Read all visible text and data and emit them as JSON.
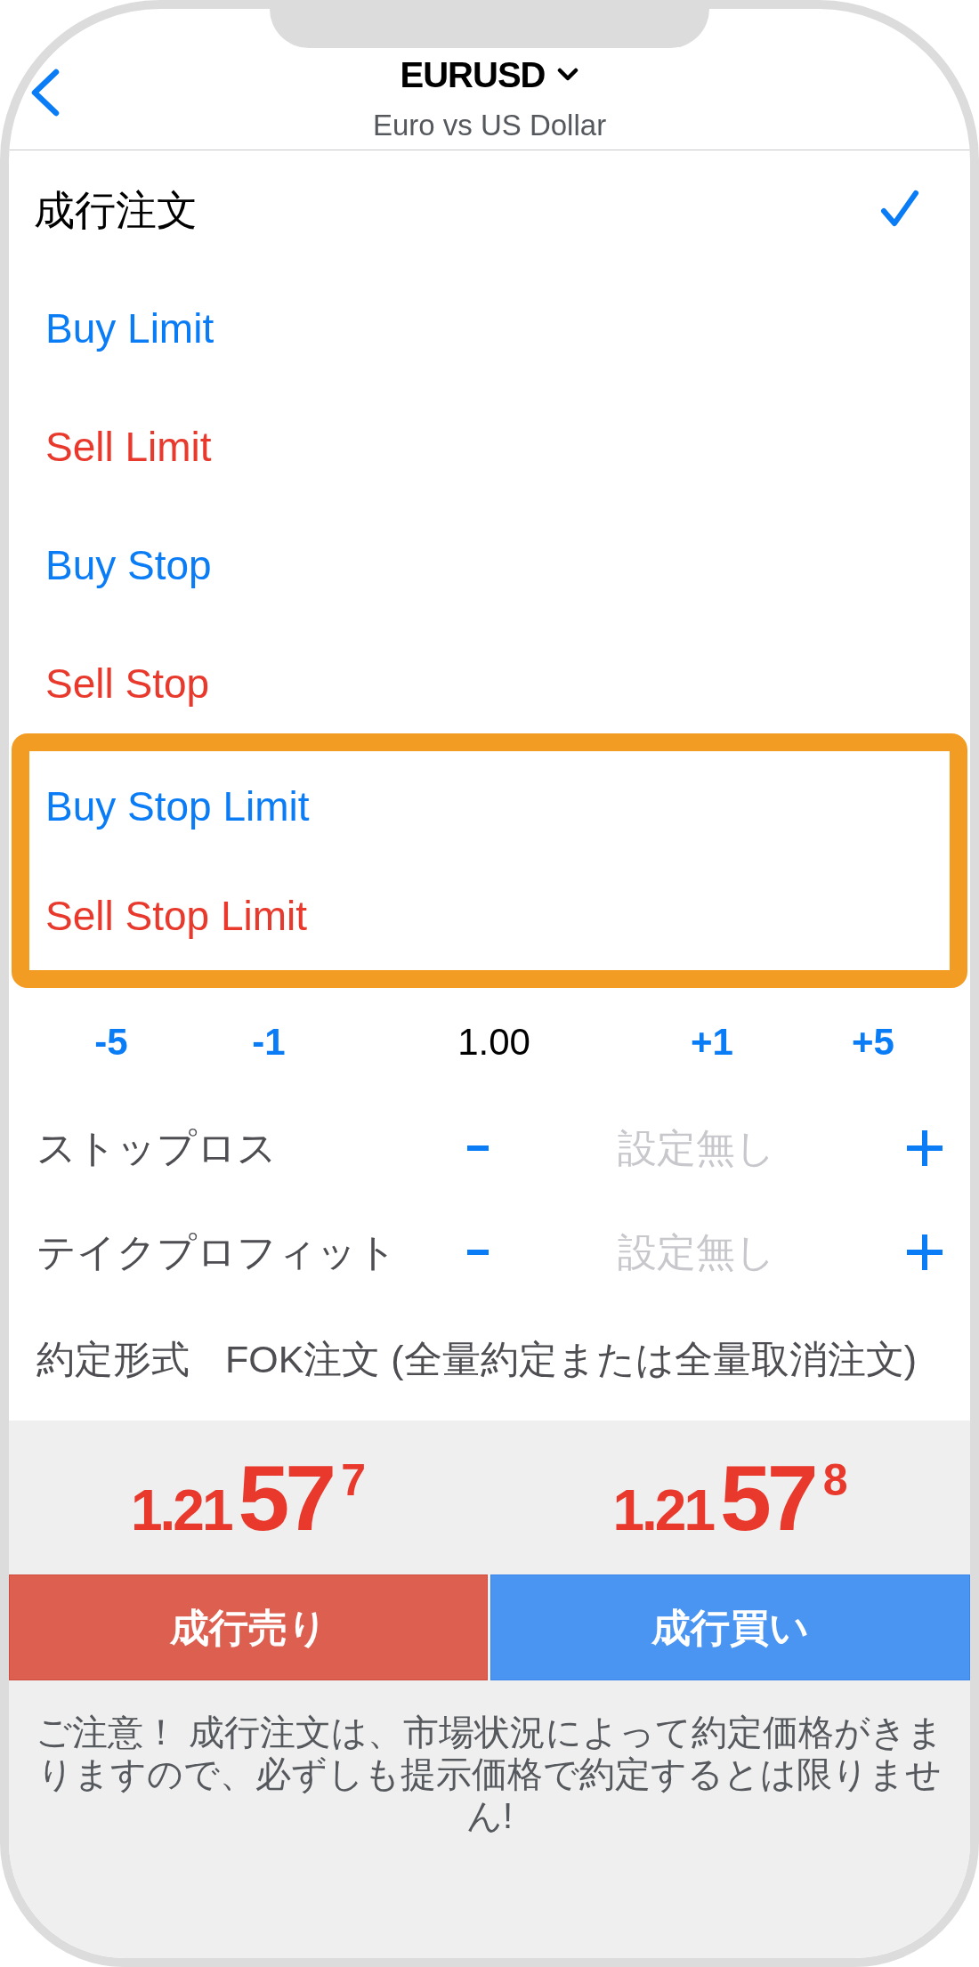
{
  "header": {
    "symbol": "EURUSD",
    "description": "Euro vs US Dollar"
  },
  "order_types": [
    {
      "label": "成行注文",
      "kind": "market",
      "selected": true,
      "highlighted": false
    },
    {
      "label": "Buy Limit",
      "kind": "buy",
      "selected": false,
      "highlighted": false
    },
    {
      "label": "Sell Limit",
      "kind": "sell",
      "selected": false,
      "highlighted": false
    },
    {
      "label": "Buy Stop",
      "kind": "buy",
      "selected": false,
      "highlighted": false
    },
    {
      "label": "Sell Stop",
      "kind": "sell",
      "selected": false,
      "highlighted": false
    },
    {
      "label": "Buy Stop Limit",
      "kind": "buy",
      "selected": false,
      "highlighted": true
    },
    {
      "label": "Sell Stop Limit",
      "kind": "sell",
      "selected": false,
      "highlighted": true
    }
  ],
  "volume": {
    "decrease_steps": [
      "-5",
      "-1"
    ],
    "value": "1.00",
    "increase_steps": [
      "+1",
      "+5"
    ]
  },
  "protection": [
    {
      "label": "ストップロス",
      "placeholder": "設定無し"
    },
    {
      "label": "テイクプロフィット",
      "placeholder": "設定無し"
    }
  ],
  "fill_policy": {
    "label": "約定形式",
    "value": "FOK注文 (全量約定または全量取消注文)"
  },
  "quotes": [
    {
      "kind": "sell",
      "price_down": true,
      "prefix": "1.21",
      "pips": "57",
      "point": "7",
      "button": "成行売り"
    },
    {
      "kind": "buy",
      "price_down": true,
      "prefix": "1.21",
      "pips": "57",
      "point": "8",
      "button": "成行買い"
    }
  ],
  "notice": "ご注意！ 成行注文は、市場状況によって約定価格がきまりますので、必ずしも提示価格で約定するとは限りません!"
}
